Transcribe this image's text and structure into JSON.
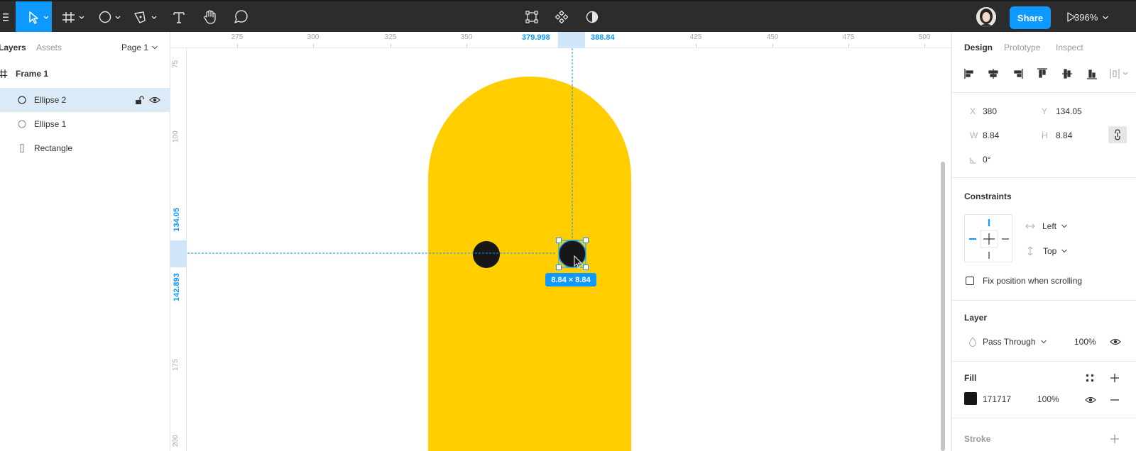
{
  "toolbar": {
    "share_label": "Share",
    "zoom": "396%"
  },
  "left_panel": {
    "tabs": [
      {
        "label": "Layers",
        "active": true
      },
      {
        "label": "Assets",
        "active": false
      }
    ],
    "page_selector": "Page 1",
    "layers": [
      {
        "label": "Frame 1",
        "type": "frame",
        "selected": false
      },
      {
        "label": "Ellipse 2",
        "type": "ellipse",
        "selected": true
      },
      {
        "label": "Ellipse 1",
        "type": "ellipse",
        "selected": false
      },
      {
        "label": "Rectangle",
        "type": "rectangle",
        "selected": false
      }
    ]
  },
  "rulers": {
    "top_ticks": [
      "275",
      "300",
      "325",
      "350",
      "425",
      "450",
      "475",
      "500"
    ],
    "top_selection_start": "379.998",
    "top_selection_end": "388.84",
    "left_ticks": [
      "75",
      "100",
      "175",
      "200"
    ],
    "left_selection_start": "134.05",
    "left_selection_end": "142.893"
  },
  "canvas": {
    "shape_color": "#ffcd00",
    "ellipse_color": "#171717",
    "selection_color": "#0d99ff",
    "selection_size_label": "8.84 × 8.84"
  },
  "right_panel": {
    "tabs": [
      {
        "label": "Design",
        "active": true
      },
      {
        "label": "Prototype",
        "active": false
      },
      {
        "label": "Inspect",
        "active": false
      }
    ],
    "x_label": "X",
    "x_value": "380",
    "y_label": "Y",
    "y_value": "134.05",
    "w_label": "W",
    "w_value": "8.84",
    "h_label": "H",
    "h_value": "8.84",
    "rotation_value": "0°",
    "constraints": {
      "title": "Constraints",
      "horizontal": "Left",
      "vertical": "Top",
      "fix_position_label": "Fix position when scrolling",
      "fix_position_checked": false
    },
    "layer": {
      "title": "Layer",
      "blend_mode": "Pass Through",
      "opacity": "100%"
    },
    "fill": {
      "title": "Fill",
      "color_hex": "171717",
      "swatch_color": "#171717",
      "opacity": "100%"
    },
    "stroke": {
      "title": "Stroke"
    }
  }
}
